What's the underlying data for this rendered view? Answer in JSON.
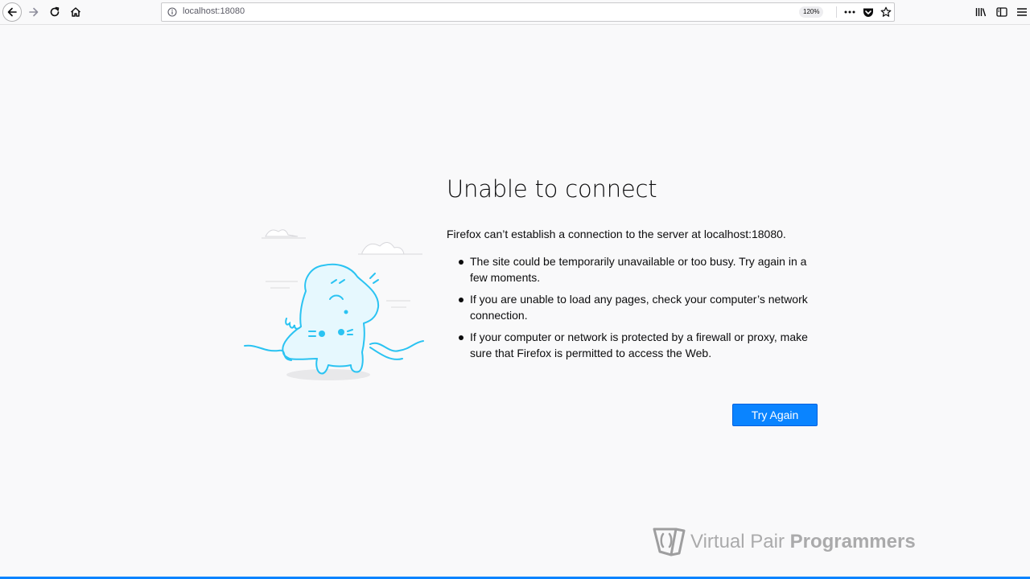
{
  "browser": {
    "url": "localhost:18080",
    "zoom": "120%"
  },
  "error_page": {
    "title": "Unable to connect",
    "lead": "Firefox can’t establish a connection to the server at localhost:18080.",
    "bullets": [
      "The site could be temporarily unavailable or too busy. Try again in a few moments.",
      "If you are unable to load any pages, check your computer’s network connection.",
      "If your computer or network is protected by a firewall or proxy, make sure that Firefox is permitted to access the Web."
    ],
    "try_again_label": "Try Again"
  },
  "watermark": {
    "text_light": "Virtual Pair ",
    "text_bold": "Programmers"
  },
  "colors": {
    "accent": "#0a84ff",
    "page_bg": "#f9f9fa",
    "illustration": "#2ac3f2"
  },
  "icons": {
    "back": "back-arrow-icon",
    "forward": "forward-arrow-icon",
    "reload": "reload-icon",
    "home": "home-icon",
    "info": "info-icon",
    "page_actions": "more-dots-icon",
    "pocket": "pocket-icon",
    "bookmark": "star-icon",
    "library": "library-icon",
    "sidebar": "sidebar-icon"
  }
}
